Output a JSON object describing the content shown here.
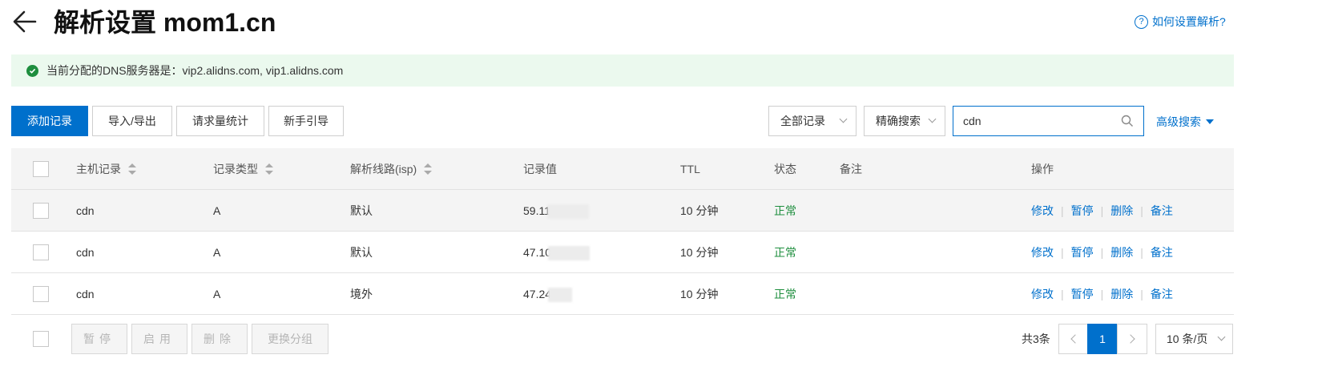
{
  "header": {
    "title": "解析设置 mom1.cn",
    "help_link": "如何设置解析?"
  },
  "notice": {
    "text": "当前分配的DNS服务器是：vip2.alidns.com, vip1.alidns.com"
  },
  "toolbar": {
    "add_record": "添加记录",
    "import_export": "导入/导出",
    "request_stats": "请求量统计",
    "guide": "新手引导",
    "record_filter": "全部记录",
    "search_mode": "精确搜索",
    "search_value": "cdn",
    "advanced_search": "高级搜索"
  },
  "table": {
    "columns": {
      "host": "主机记录",
      "type": "记录类型",
      "line": "解析线路(isp)",
      "value": "记录值",
      "ttl": "TTL",
      "status": "状态",
      "remark": "备注",
      "actions": "操作"
    },
    "rows": [
      {
        "host": "cdn",
        "type": "A",
        "line": "默认",
        "value": "59.11",
        "ttl": "10 分钟",
        "status": "正常",
        "remark": ""
      },
      {
        "host": "cdn",
        "type": "A",
        "line": "默认",
        "value": "47.10",
        "ttl": "10 分钟",
        "status": "正常",
        "remark": ""
      },
      {
        "host": "cdn",
        "type": "A",
        "line": "境外",
        "value": "47.24",
        "ttl": "10 分钟",
        "status": "正常",
        "remark": ""
      }
    ],
    "actions": {
      "edit": "修改",
      "pause": "暂停",
      "delete": "删除",
      "remark": "备注"
    }
  },
  "footer": {
    "pause": "暂停",
    "enable": "启用",
    "delete": "删除",
    "change_group": "更换分组",
    "total": "共3条",
    "current_page": "1",
    "page_size": "10 条/页"
  },
  "colors": {
    "primary": "#0070cc",
    "success": "#1e8e3e",
    "notice_bg": "#ebf9ee",
    "header_bg": "#f4f4f4"
  }
}
